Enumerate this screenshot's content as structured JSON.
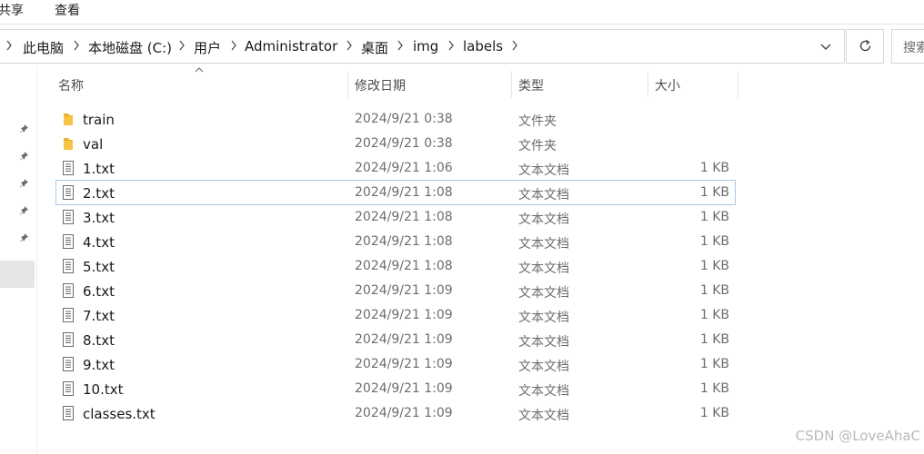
{
  "ribbon": {
    "tabs": [
      "共享",
      "查看"
    ]
  },
  "address_bar": {
    "crumbs": [
      "此电脑",
      "本地磁盘 (C:)",
      "用户",
      "Administrator",
      "桌面",
      "img",
      "labels"
    ]
  },
  "search": {
    "placeholder": "搜索"
  },
  "columns": {
    "name": "名称",
    "modified": "修改日期",
    "type": "类型",
    "size": "大小"
  },
  "files": [
    {
      "name": "train",
      "modified": "2024/9/21 0:38",
      "type": "文件夹",
      "size": "",
      "kind": "folder"
    },
    {
      "name": "val",
      "modified": "2024/9/21 0:38",
      "type": "文件夹",
      "size": "",
      "kind": "folder"
    },
    {
      "name": "1.txt",
      "modified": "2024/9/21 1:06",
      "type": "文本文档",
      "size": "1 KB",
      "kind": "text"
    },
    {
      "name": "2.txt",
      "modified": "2024/9/21 1:08",
      "type": "文本文档",
      "size": "1 KB",
      "kind": "text",
      "selected": true
    },
    {
      "name": "3.txt",
      "modified": "2024/9/21 1:08",
      "type": "文本文档",
      "size": "1 KB",
      "kind": "text"
    },
    {
      "name": "4.txt",
      "modified": "2024/9/21 1:08",
      "type": "文本文档",
      "size": "1 KB",
      "kind": "text"
    },
    {
      "name": "5.txt",
      "modified": "2024/9/21 1:08",
      "type": "文本文档",
      "size": "1 KB",
      "kind": "text"
    },
    {
      "name": "6.txt",
      "modified": "2024/9/21 1:09",
      "type": "文本文档",
      "size": "1 KB",
      "kind": "text"
    },
    {
      "name": "7.txt",
      "modified": "2024/9/21 1:09",
      "type": "文本文档",
      "size": "1 KB",
      "kind": "text"
    },
    {
      "name": "8.txt",
      "modified": "2024/9/21 1:09",
      "type": "文本文档",
      "size": "1 KB",
      "kind": "text"
    },
    {
      "name": "9.txt",
      "modified": "2024/9/21 1:09",
      "type": "文本文档",
      "size": "1 KB",
      "kind": "text"
    },
    {
      "name": "10.txt",
      "modified": "2024/9/21 1:09",
      "type": "文本文档",
      "size": "1 KB",
      "kind": "text"
    },
    {
      "name": "classes.txt",
      "modified": "2024/9/21 1:09",
      "type": "文本文档",
      "size": "1 KB",
      "kind": "text"
    }
  ],
  "watermark": "CSDN @LoveAhaC",
  "colors": {
    "folder": "#f6c343",
    "selection_border": "#a6cbe8",
    "header_divider": "#e5e5e5"
  }
}
